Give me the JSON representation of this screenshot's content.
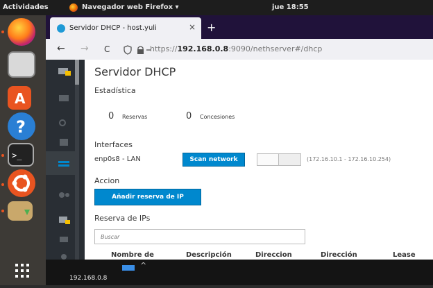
{
  "topbar": {
    "activities": "Actividades",
    "app_menu": "Navegador web Firefox ▾",
    "clock": "jue 18:55"
  },
  "browser": {
    "tab_title": "Servidor DHCP - host.yuli",
    "tab_close": "×",
    "new_tab": "+",
    "nav": {
      "back": "←",
      "forward": "→",
      "reload": "C",
      "url_host": "192.168.0.8",
      "url_prefix": "https://",
      "url_rest": ":9090/nethserver#/dhcp"
    }
  },
  "page": {
    "title": "Servidor DHCP",
    "stats_heading": "Estadística",
    "stats": [
      {
        "value": "0",
        "label": "Reservas"
      },
      {
        "value": "0",
        "label": "Concesiones"
      }
    ],
    "interfaces_heading": "Interfaces",
    "interface": {
      "name": "enp0s8 - LAN",
      "scan_button": "Scan network",
      "toggle_on": false,
      "range": "(172.16.10.1 - 172.16.10.254)"
    },
    "action_heading": "Accion",
    "add_button": "Añadir reserva de IP",
    "reservations_heading": "Reserva de IPs",
    "search_placeholder": "Buscar",
    "table_headers": [
      "Nombre de",
      "Descripción",
      "Direccion",
      "Dirección",
      "Lease"
    ]
  },
  "statusbar": {
    "ip": "192.168.0.8",
    "arrow": "^"
  },
  "colors": {
    "accent": "#0088ce",
    "ubuntu_orange": "#e95420",
    "nav_dark": "#292e34"
  }
}
